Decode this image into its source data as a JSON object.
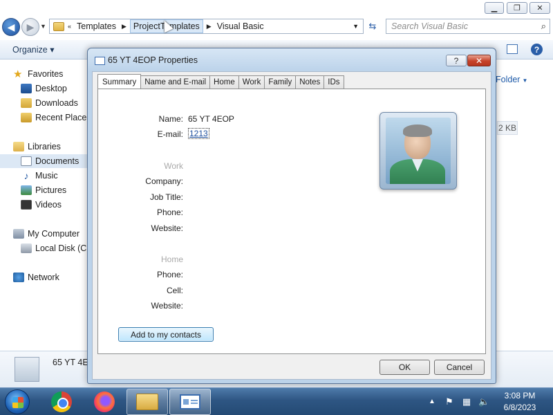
{
  "explorer": {
    "window_controls": {
      "minimize": "▁",
      "maximize": "❐",
      "close": "✕"
    },
    "address": {
      "collapse": "«",
      "segments": [
        "Templates",
        "ProjectTemplates",
        "Visual Basic"
      ]
    },
    "search_placeholder": "Search Visual Basic",
    "toolbar": {
      "organize": "Organize"
    },
    "new_folder": "Folder",
    "size_cell": "2 KB",
    "nav": {
      "favorites": "Favorites",
      "desktop": "Desktop",
      "downloads": "Downloads",
      "recent_places": "Recent Places",
      "libraries": "Libraries",
      "documents": "Documents",
      "music": "Music",
      "pictures": "Pictures",
      "videos": "Videos",
      "my_computer": "My Computer",
      "local_disk": "Local Disk (C:)",
      "network": "Network"
    },
    "details": {
      "name": "65 YT 4E"
    }
  },
  "dialog": {
    "title": "65 YT 4EOP Properties",
    "tabs": [
      "Summary",
      "Name and E-mail",
      "Home",
      "Work",
      "Family",
      "Notes",
      "IDs"
    ],
    "active_tab": "Summary",
    "fields": {
      "name_label": "Name:",
      "name_value": "65 YT 4EOP",
      "email_label": "E-mail:",
      "email_value": "1213",
      "work_section": "Work",
      "company_label": "Company:",
      "job_title_label": "Job Title:",
      "work_phone_label": "Phone:",
      "work_website_label": "Website:",
      "home_section": "Home",
      "home_phone_label": "Phone:",
      "cell_label": "Cell:",
      "home_website_label": "Website:"
    },
    "add_contacts_label": "Add to my contacts",
    "ok_label": "OK",
    "cancel_label": "Cancel",
    "help_glyph": "?",
    "close_glyph": "✕"
  },
  "taskbar": {
    "apps": [
      "chrome-icon",
      "firefox-icon",
      "explorer-icon",
      "contact-properties-icon"
    ],
    "clock": {
      "time": "3:08 PM",
      "date": "6/8/2023"
    }
  }
}
